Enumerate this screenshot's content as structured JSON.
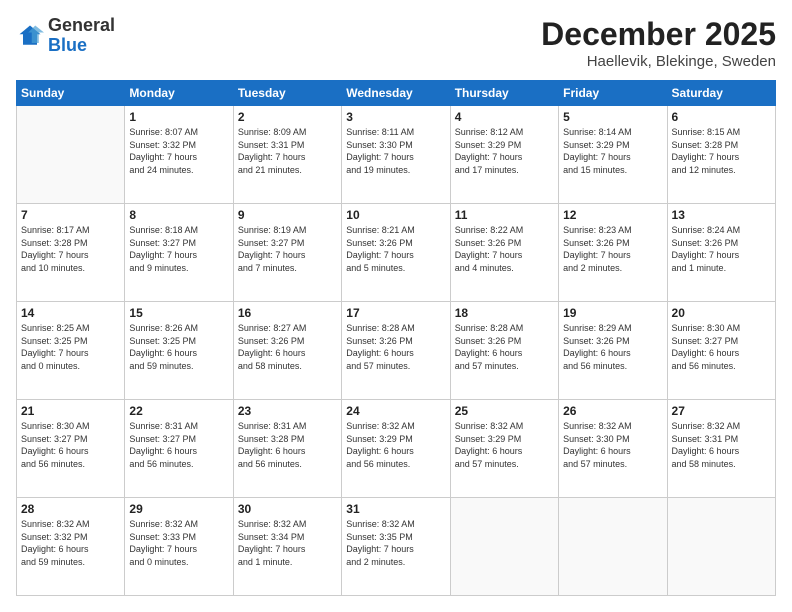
{
  "header": {
    "logo_line1": "General",
    "logo_line2": "Blue",
    "month": "December 2025",
    "location": "Haellevik, Blekinge, Sweden"
  },
  "days_of_week": [
    "Sunday",
    "Monday",
    "Tuesday",
    "Wednesday",
    "Thursday",
    "Friday",
    "Saturday"
  ],
  "weeks": [
    [
      {
        "day": "",
        "info": ""
      },
      {
        "day": "1",
        "info": "Sunrise: 8:07 AM\nSunset: 3:32 PM\nDaylight: 7 hours\nand 24 minutes."
      },
      {
        "day": "2",
        "info": "Sunrise: 8:09 AM\nSunset: 3:31 PM\nDaylight: 7 hours\nand 21 minutes."
      },
      {
        "day": "3",
        "info": "Sunrise: 8:11 AM\nSunset: 3:30 PM\nDaylight: 7 hours\nand 19 minutes."
      },
      {
        "day": "4",
        "info": "Sunrise: 8:12 AM\nSunset: 3:29 PM\nDaylight: 7 hours\nand 17 minutes."
      },
      {
        "day": "5",
        "info": "Sunrise: 8:14 AM\nSunset: 3:29 PM\nDaylight: 7 hours\nand 15 minutes."
      },
      {
        "day": "6",
        "info": "Sunrise: 8:15 AM\nSunset: 3:28 PM\nDaylight: 7 hours\nand 12 minutes."
      }
    ],
    [
      {
        "day": "7",
        "info": "Sunrise: 8:17 AM\nSunset: 3:28 PM\nDaylight: 7 hours\nand 10 minutes."
      },
      {
        "day": "8",
        "info": "Sunrise: 8:18 AM\nSunset: 3:27 PM\nDaylight: 7 hours\nand 9 minutes."
      },
      {
        "day": "9",
        "info": "Sunrise: 8:19 AM\nSunset: 3:27 PM\nDaylight: 7 hours\nand 7 minutes."
      },
      {
        "day": "10",
        "info": "Sunrise: 8:21 AM\nSunset: 3:26 PM\nDaylight: 7 hours\nand 5 minutes."
      },
      {
        "day": "11",
        "info": "Sunrise: 8:22 AM\nSunset: 3:26 PM\nDaylight: 7 hours\nand 4 minutes."
      },
      {
        "day": "12",
        "info": "Sunrise: 8:23 AM\nSunset: 3:26 PM\nDaylight: 7 hours\nand 2 minutes."
      },
      {
        "day": "13",
        "info": "Sunrise: 8:24 AM\nSunset: 3:26 PM\nDaylight: 7 hours\nand 1 minute."
      }
    ],
    [
      {
        "day": "14",
        "info": "Sunrise: 8:25 AM\nSunset: 3:25 PM\nDaylight: 7 hours\nand 0 minutes."
      },
      {
        "day": "15",
        "info": "Sunrise: 8:26 AM\nSunset: 3:25 PM\nDaylight: 6 hours\nand 59 minutes."
      },
      {
        "day": "16",
        "info": "Sunrise: 8:27 AM\nSunset: 3:26 PM\nDaylight: 6 hours\nand 58 minutes."
      },
      {
        "day": "17",
        "info": "Sunrise: 8:28 AM\nSunset: 3:26 PM\nDaylight: 6 hours\nand 57 minutes."
      },
      {
        "day": "18",
        "info": "Sunrise: 8:28 AM\nSunset: 3:26 PM\nDaylight: 6 hours\nand 57 minutes."
      },
      {
        "day": "19",
        "info": "Sunrise: 8:29 AM\nSunset: 3:26 PM\nDaylight: 6 hours\nand 56 minutes."
      },
      {
        "day": "20",
        "info": "Sunrise: 8:30 AM\nSunset: 3:27 PM\nDaylight: 6 hours\nand 56 minutes."
      }
    ],
    [
      {
        "day": "21",
        "info": "Sunrise: 8:30 AM\nSunset: 3:27 PM\nDaylight: 6 hours\nand 56 minutes."
      },
      {
        "day": "22",
        "info": "Sunrise: 8:31 AM\nSunset: 3:27 PM\nDaylight: 6 hours\nand 56 minutes."
      },
      {
        "day": "23",
        "info": "Sunrise: 8:31 AM\nSunset: 3:28 PM\nDaylight: 6 hours\nand 56 minutes."
      },
      {
        "day": "24",
        "info": "Sunrise: 8:32 AM\nSunset: 3:29 PM\nDaylight: 6 hours\nand 56 minutes."
      },
      {
        "day": "25",
        "info": "Sunrise: 8:32 AM\nSunset: 3:29 PM\nDaylight: 6 hours\nand 57 minutes."
      },
      {
        "day": "26",
        "info": "Sunrise: 8:32 AM\nSunset: 3:30 PM\nDaylight: 6 hours\nand 57 minutes."
      },
      {
        "day": "27",
        "info": "Sunrise: 8:32 AM\nSunset: 3:31 PM\nDaylight: 6 hours\nand 58 minutes."
      }
    ],
    [
      {
        "day": "28",
        "info": "Sunrise: 8:32 AM\nSunset: 3:32 PM\nDaylight: 6 hours\nand 59 minutes."
      },
      {
        "day": "29",
        "info": "Sunrise: 8:32 AM\nSunset: 3:33 PM\nDaylight: 7 hours\nand 0 minutes."
      },
      {
        "day": "30",
        "info": "Sunrise: 8:32 AM\nSunset: 3:34 PM\nDaylight: 7 hours\nand 1 minute."
      },
      {
        "day": "31",
        "info": "Sunrise: 8:32 AM\nSunset: 3:35 PM\nDaylight: 7 hours\nand 2 minutes."
      },
      {
        "day": "",
        "info": ""
      },
      {
        "day": "",
        "info": ""
      },
      {
        "day": "",
        "info": ""
      }
    ]
  ]
}
